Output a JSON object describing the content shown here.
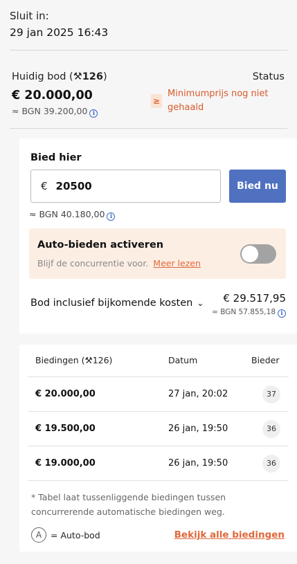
{
  "closing": {
    "label": "Sluit in:",
    "date": "29 jan 2025 16:43"
  },
  "current_bid": {
    "label_prefix": "Huidig bod (",
    "bid_count": "126",
    "label_suffix": ")",
    "amount": "€ 20.000,00",
    "bgn": "≈ BGN 39.200,00"
  },
  "status": {
    "label": "Status",
    "badge": "≥",
    "text": "Minimumprijs nog niet gehaald"
  },
  "bid_form": {
    "title": "Bied hier",
    "currency": "€",
    "input_value": "20500",
    "button_label": "Bied nu",
    "bgn": "≈ BGN 40.180,00"
  },
  "auto_bid": {
    "title": "Auto-bieden activeren",
    "subtitle": "Blijf de concurrentie voor.",
    "link": "Meer lezen",
    "enabled": false
  },
  "inclusive": {
    "label": "Bod inclusief bijkomende kosten",
    "amount": "€ 29.517,95",
    "bgn": "≈ BGN 57.855,18"
  },
  "bids_table": {
    "headers": {
      "bids_prefix": "Biedingen (",
      "bids_count": "126",
      "bids_suffix": ")",
      "date": "Datum",
      "bidder": "Bieder"
    },
    "rows": [
      {
        "amount": "€ 20.000,00",
        "date": "27 jan, 20:02",
        "bidder": "37"
      },
      {
        "amount": "€ 19.500,00",
        "date": "26 jan, 19:50",
        "bidder": "36"
      },
      {
        "amount": "€ 19.000,00",
        "date": "26 jan, 19:50",
        "bidder": "36"
      }
    ],
    "footnote": "* Tabel laat tussenliggende biedingen tussen concurrerende automatische biedingen weg.",
    "auto_symbol": "A",
    "auto_legend": "= Auto-bod",
    "all_bids_link": "Bekijk alle biedingen"
  },
  "colors": {
    "accent": "#e0683a",
    "primary_button": "#4f71c0",
    "info": "#3a67c6"
  }
}
